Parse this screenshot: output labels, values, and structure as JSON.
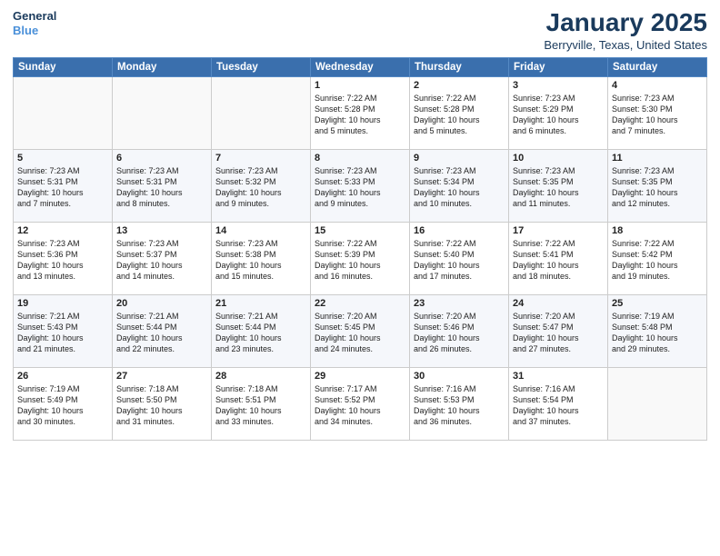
{
  "logo": {
    "line1": "General",
    "line2": "Blue"
  },
  "title": "January 2025",
  "location": "Berryville, Texas, United States",
  "weekdays": [
    "Sunday",
    "Monday",
    "Tuesday",
    "Wednesday",
    "Thursday",
    "Friday",
    "Saturday"
  ],
  "weeks": [
    [
      {
        "day": "",
        "info": ""
      },
      {
        "day": "",
        "info": ""
      },
      {
        "day": "",
        "info": ""
      },
      {
        "day": "1",
        "info": "Sunrise: 7:22 AM\nSunset: 5:28 PM\nDaylight: 10 hours\nand 5 minutes."
      },
      {
        "day": "2",
        "info": "Sunrise: 7:22 AM\nSunset: 5:28 PM\nDaylight: 10 hours\nand 5 minutes."
      },
      {
        "day": "3",
        "info": "Sunrise: 7:23 AM\nSunset: 5:29 PM\nDaylight: 10 hours\nand 6 minutes."
      },
      {
        "day": "4",
        "info": "Sunrise: 7:23 AM\nSunset: 5:30 PM\nDaylight: 10 hours\nand 7 minutes."
      }
    ],
    [
      {
        "day": "5",
        "info": "Sunrise: 7:23 AM\nSunset: 5:31 PM\nDaylight: 10 hours\nand 7 minutes."
      },
      {
        "day": "6",
        "info": "Sunrise: 7:23 AM\nSunset: 5:31 PM\nDaylight: 10 hours\nand 8 minutes."
      },
      {
        "day": "7",
        "info": "Sunrise: 7:23 AM\nSunset: 5:32 PM\nDaylight: 10 hours\nand 9 minutes."
      },
      {
        "day": "8",
        "info": "Sunrise: 7:23 AM\nSunset: 5:33 PM\nDaylight: 10 hours\nand 9 minutes."
      },
      {
        "day": "9",
        "info": "Sunrise: 7:23 AM\nSunset: 5:34 PM\nDaylight: 10 hours\nand 10 minutes."
      },
      {
        "day": "10",
        "info": "Sunrise: 7:23 AM\nSunset: 5:35 PM\nDaylight: 10 hours\nand 11 minutes."
      },
      {
        "day": "11",
        "info": "Sunrise: 7:23 AM\nSunset: 5:35 PM\nDaylight: 10 hours\nand 12 minutes."
      }
    ],
    [
      {
        "day": "12",
        "info": "Sunrise: 7:23 AM\nSunset: 5:36 PM\nDaylight: 10 hours\nand 13 minutes."
      },
      {
        "day": "13",
        "info": "Sunrise: 7:23 AM\nSunset: 5:37 PM\nDaylight: 10 hours\nand 14 minutes."
      },
      {
        "day": "14",
        "info": "Sunrise: 7:23 AM\nSunset: 5:38 PM\nDaylight: 10 hours\nand 15 minutes."
      },
      {
        "day": "15",
        "info": "Sunrise: 7:22 AM\nSunset: 5:39 PM\nDaylight: 10 hours\nand 16 minutes."
      },
      {
        "day": "16",
        "info": "Sunrise: 7:22 AM\nSunset: 5:40 PM\nDaylight: 10 hours\nand 17 minutes."
      },
      {
        "day": "17",
        "info": "Sunrise: 7:22 AM\nSunset: 5:41 PM\nDaylight: 10 hours\nand 18 minutes."
      },
      {
        "day": "18",
        "info": "Sunrise: 7:22 AM\nSunset: 5:42 PM\nDaylight: 10 hours\nand 19 minutes."
      }
    ],
    [
      {
        "day": "19",
        "info": "Sunrise: 7:21 AM\nSunset: 5:43 PM\nDaylight: 10 hours\nand 21 minutes."
      },
      {
        "day": "20",
        "info": "Sunrise: 7:21 AM\nSunset: 5:44 PM\nDaylight: 10 hours\nand 22 minutes."
      },
      {
        "day": "21",
        "info": "Sunrise: 7:21 AM\nSunset: 5:44 PM\nDaylight: 10 hours\nand 23 minutes."
      },
      {
        "day": "22",
        "info": "Sunrise: 7:20 AM\nSunset: 5:45 PM\nDaylight: 10 hours\nand 24 minutes."
      },
      {
        "day": "23",
        "info": "Sunrise: 7:20 AM\nSunset: 5:46 PM\nDaylight: 10 hours\nand 26 minutes."
      },
      {
        "day": "24",
        "info": "Sunrise: 7:20 AM\nSunset: 5:47 PM\nDaylight: 10 hours\nand 27 minutes."
      },
      {
        "day": "25",
        "info": "Sunrise: 7:19 AM\nSunset: 5:48 PM\nDaylight: 10 hours\nand 29 minutes."
      }
    ],
    [
      {
        "day": "26",
        "info": "Sunrise: 7:19 AM\nSunset: 5:49 PM\nDaylight: 10 hours\nand 30 minutes."
      },
      {
        "day": "27",
        "info": "Sunrise: 7:18 AM\nSunset: 5:50 PM\nDaylight: 10 hours\nand 31 minutes."
      },
      {
        "day": "28",
        "info": "Sunrise: 7:18 AM\nSunset: 5:51 PM\nDaylight: 10 hours\nand 33 minutes."
      },
      {
        "day": "29",
        "info": "Sunrise: 7:17 AM\nSunset: 5:52 PM\nDaylight: 10 hours\nand 34 minutes."
      },
      {
        "day": "30",
        "info": "Sunrise: 7:16 AM\nSunset: 5:53 PM\nDaylight: 10 hours\nand 36 minutes."
      },
      {
        "day": "31",
        "info": "Sunrise: 7:16 AM\nSunset: 5:54 PM\nDaylight: 10 hours\nand 37 minutes."
      },
      {
        "day": "",
        "info": ""
      }
    ]
  ]
}
